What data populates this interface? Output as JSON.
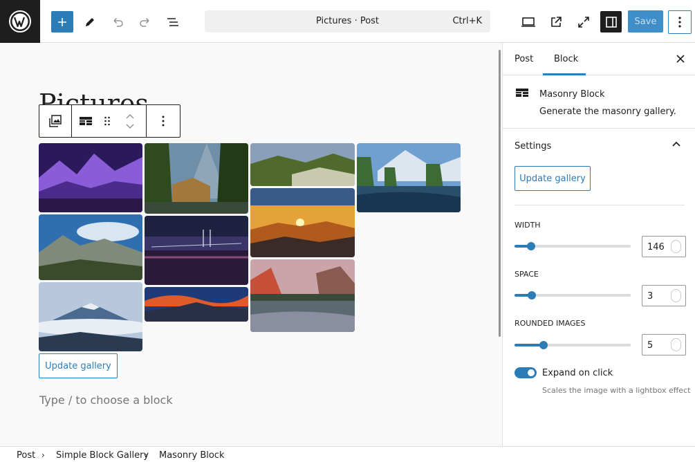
{
  "header": {
    "command_title": "Pictures · Post",
    "command_shortcut": "Ctrl+K",
    "save_label": "Save",
    "icons": [
      "wordpress-icon",
      "plus-icon",
      "pencil-icon",
      "undo-icon",
      "redo-icon",
      "list-view-icon",
      "desktop-icon",
      "external-link-icon",
      "fullscreen-icon",
      "sidebar-icon",
      "more-vertical-icon"
    ]
  },
  "editor": {
    "post_title": "Pictures",
    "gallery": {
      "images": [
        {
          "name": "purple-valley-image",
          "colors": [
            "#4b2c8c",
            "#8a5cd8",
            "#2a1846"
          ]
        },
        {
          "name": "forest-river-image",
          "colors": [
            "#6f8fa8",
            "#2f4a1f",
            "#a3783a"
          ]
        },
        {
          "name": "green-hills-image",
          "colors": [
            "#8aa0b8",
            "#4f6a2c",
            "#c9c9b0"
          ]
        },
        {
          "name": "lake-mountain-image",
          "colors": [
            "#6fa0d0",
            "#3e6a36",
            "#2a4f6a"
          ]
        },
        {
          "name": "sunset-mountains-image",
          "colors": [
            "#e6a23a",
            "#b05a1e",
            "#3a2a28"
          ]
        },
        {
          "name": "mountain-vista-image",
          "colors": [
            "#2f6fb0",
            "#7f8a7a",
            "#3a4a2a"
          ]
        },
        {
          "name": "night-bridge-image",
          "colors": [
            "#1e2240",
            "#3a3468",
            "#8a4a7a"
          ]
        },
        {
          "name": "mount-fuji-image",
          "colors": [
            "#b7c8dc",
            "#e8eef4",
            "#2a3a50"
          ]
        },
        {
          "name": "red-sky-mountain-image",
          "colors": [
            "#1f3a78",
            "#e05a2a",
            "#2a2f48"
          ]
        },
        {
          "name": "sunrise-cliffs-image",
          "colors": [
            "#c9a4a8",
            "#c8503a",
            "#5a6a70"
          ]
        }
      ]
    },
    "update_gallery_label": "Update gallery",
    "placeholder": "Type / to choose a block"
  },
  "sidebar": {
    "tabs": [
      {
        "label": "Post"
      },
      {
        "label": "Block"
      }
    ],
    "block_title": "Masonry Block",
    "block_description": "Generate the masonry gallery.",
    "panel_title": "Settings",
    "update_gallery_label": "Update gallery",
    "width": {
      "label": "WIDTH",
      "value": "146",
      "fraction": 0.14
    },
    "space": {
      "label": "SPACE",
      "value": "3",
      "fraction": 0.15
    },
    "rounded": {
      "label": "ROUNDED IMAGES",
      "value": "5",
      "fraction": 0.25
    },
    "expand": {
      "label": "Expand on click",
      "help": "Scales the image with a lightbox effect",
      "enabled": true
    }
  },
  "footer": {
    "breadcrumbs": [
      "Post",
      "Simple Block Gallery",
      "Masonry Block"
    ]
  },
  "colors": {
    "accent": "#2c7cb7",
    "dark": "#1e1e1e"
  }
}
